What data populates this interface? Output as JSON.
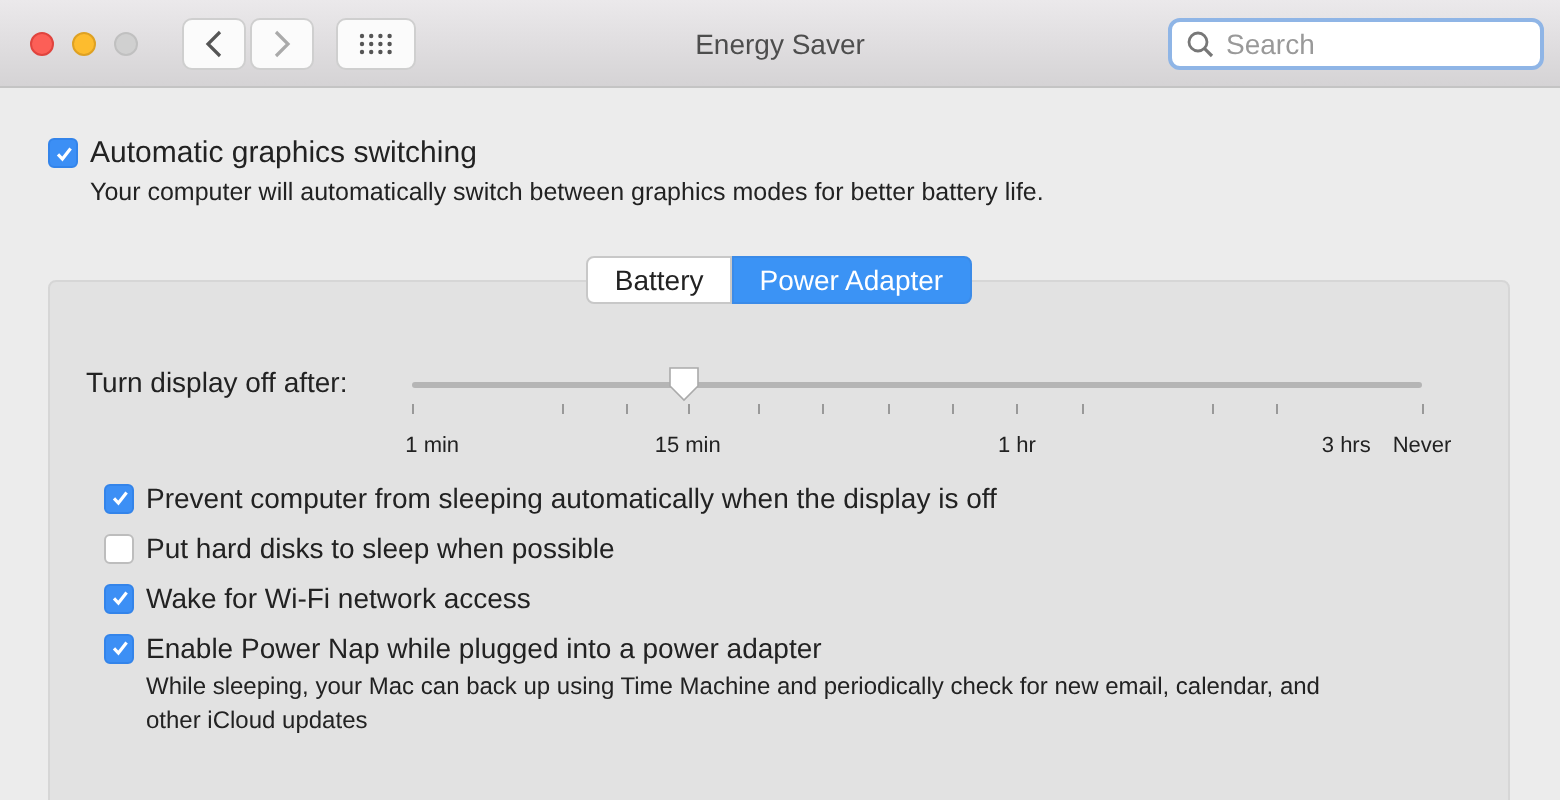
{
  "window": {
    "title": "Energy Saver"
  },
  "search": {
    "placeholder": "Search"
  },
  "graphics_switching": {
    "label": "Automatic graphics switching",
    "checked": true,
    "description": "Your computer will automatically switch between graphics modes for better battery life."
  },
  "tabs": [
    {
      "label": "Battery",
      "selected": false
    },
    {
      "label": "Power Adapter",
      "selected": true
    }
  ],
  "display_slider": {
    "label": "Turn display off after:",
    "level": 0.27,
    "tick_labels": [
      "1 min",
      "15 min",
      "1 hr",
      "3 hrs",
      "Never"
    ]
  },
  "options": [
    {
      "label": "Prevent computer from sleeping automatically when the display is off",
      "checked": true
    },
    {
      "label": "Put hard disks to sleep when possible",
      "checked": false
    },
    {
      "label": "Wake for Wi-Fi network access",
      "checked": true
    },
    {
      "label": "Enable Power Nap while plugged into a power adapter",
      "checked": true,
      "description": "While sleeping, your Mac can back up using Time Machine and periodically check for new email, calendar, and other iCloud updates"
    }
  ]
}
